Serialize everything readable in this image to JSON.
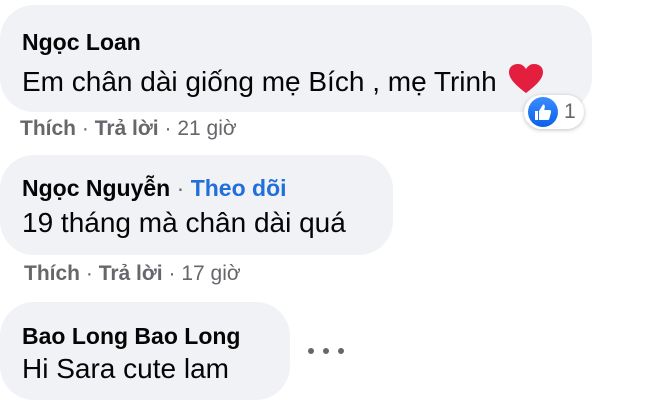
{
  "comments": [
    {
      "author": "Ngọc Loan",
      "text": "Em chân dài giống mẹ Bích , mẹ Trinh",
      "emoji": "heart",
      "actions": {
        "like": "Thích",
        "reply": "Trả lời",
        "time": "21 giờ",
        "sep1": "·",
        "sep2": "·"
      },
      "reaction": {
        "type": "like-icon",
        "count": "1"
      }
    },
    {
      "author": "Ngọc Nguyễn",
      "sep": "·",
      "follow": "Theo dõi",
      "text": "19 tháng mà chân dài quá",
      "actions": {
        "like": "Thích",
        "reply": "Trả lời",
        "time": "17 giờ",
        "sep1": "·",
        "sep2": "·"
      }
    },
    {
      "author": "Bao Long Bao Long",
      "text": "Hi Sara cute lam"
    }
  ],
  "colors": {
    "bubble": "#f0f2f5",
    "link": "#216fdb",
    "muted": "#65676b",
    "heart": "#e41e3f"
  }
}
